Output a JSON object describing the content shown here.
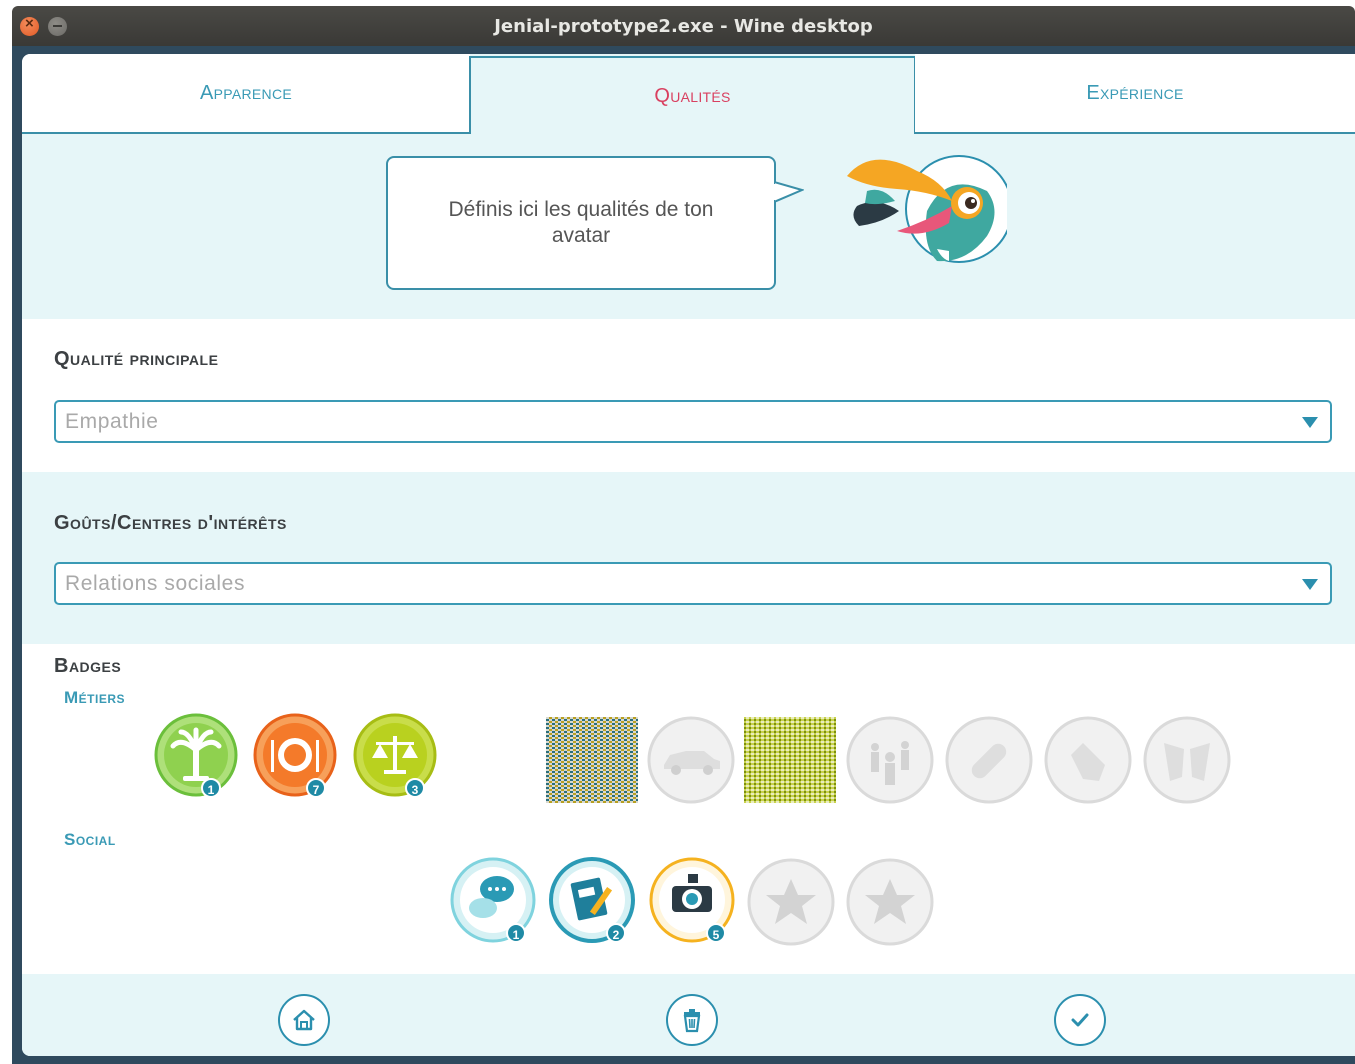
{
  "window": {
    "title": "Jenial-prototype2.exe - Wine desktop"
  },
  "tabs": [
    {
      "label": "Apparence",
      "active": false
    },
    {
      "label": "Qualités",
      "active": true
    },
    {
      "label": "Expérience",
      "active": false
    }
  ],
  "bubble": {
    "text": "Définis ici les qualités de ton avatar"
  },
  "qualite": {
    "label": "Qualité principale",
    "value": "Empathie"
  },
  "gouts": {
    "label": "Goûts/Centres d'intérêts",
    "value": "Relations sociales"
  },
  "badges": {
    "label": "Badges",
    "metiers": {
      "label": "Métiers",
      "earned": [
        {
          "icon": "palm-tree-icon",
          "count": "1",
          "color": "#8fd14f"
        },
        {
          "icon": "plate-icon",
          "count": "7",
          "color": "#f47a2a"
        },
        {
          "icon": "scales-icon",
          "count": "3",
          "color": "#b9d11f"
        }
      ],
      "locked": [
        "noise-placeholder-1",
        "car-icon",
        "noise-placeholder-2",
        "family-icon",
        "pill-icon",
        "glove-icon",
        "masks-icon"
      ]
    },
    "social": {
      "label": "Social",
      "earned": [
        {
          "icon": "chat-icon",
          "count": "1",
          "color": "#7fd3de"
        },
        {
          "icon": "notebook-icon",
          "count": "2",
          "color": "#2a9ab5"
        },
        {
          "icon": "camera-icon",
          "count": "5",
          "color": "#f5b21f"
        }
      ],
      "locked": [
        "star-icon",
        "star-icon"
      ]
    }
  },
  "footer": {
    "home": "home-icon",
    "delete": "trash-icon",
    "confirm": "check-icon"
  },
  "colors": {
    "accent": "#3a9ab5",
    "active_tab": "#d94060",
    "panel_bg": "#e6f6f8"
  }
}
